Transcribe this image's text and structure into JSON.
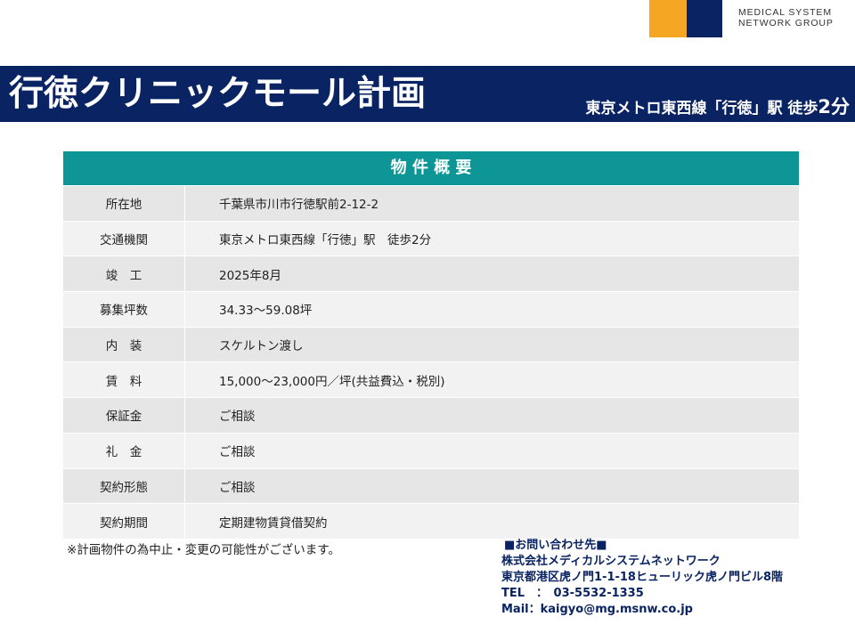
{
  "logo": {
    "line1": "MEDICAL SYSTEM",
    "line2": "NETWORK GROUP",
    "colors": {
      "orange": "#f5a623",
      "navy": "#0a2463"
    }
  },
  "header": {
    "title": "行徳クリニックモール計画",
    "access_prefix": "東京メトロ東西線「行徳」駅 徒歩",
    "access_minutes": "2分"
  },
  "table": {
    "heading": "物 件 概 要",
    "rows": [
      {
        "label": "所在地",
        "value": "千葉県市川市行徳駅前2-12-2"
      },
      {
        "label": "交通機関",
        "value": "東京メトロ東西線「行徳」駅　徒歩2分"
      },
      {
        "label": "竣　工",
        "value": "2025年8月"
      },
      {
        "label": "募集坪数",
        "value": "34.33～59.08坪"
      },
      {
        "label": "内　装",
        "value": "スケルトン渡し"
      },
      {
        "label": "賃　料",
        "value": "15,000～23,000円／坪(共益費込・税別)"
      },
      {
        "label": "保証金",
        "value": "ご相談"
      },
      {
        "label": "礼　金",
        "value": "ご相談"
      },
      {
        "label": "契約形態",
        "value": "ご相談"
      },
      {
        "label": "契約期間",
        "value": "定期建物賃貸借契約"
      }
    ]
  },
  "note": "※計画物件の為中止・変更の可能性がございます。",
  "contact": {
    "heading": "■お問い合わせ先■",
    "company": "株式会社メディカルシステムネットワーク",
    "address": "東京都港区虎ノ門1-1-18ヒューリック虎ノ門ビル8階",
    "tel": "TEL　：　03-5532-1335",
    "mail": "Mail：kaigyo@mg.msnw.co.jp"
  },
  "colors": {
    "title_bar": "#0a2463",
    "table_header": "#0e9696",
    "row_odd": "#e6e6e6",
    "row_even": "#f2f2f2",
    "contact_text": "#0a2463"
  }
}
